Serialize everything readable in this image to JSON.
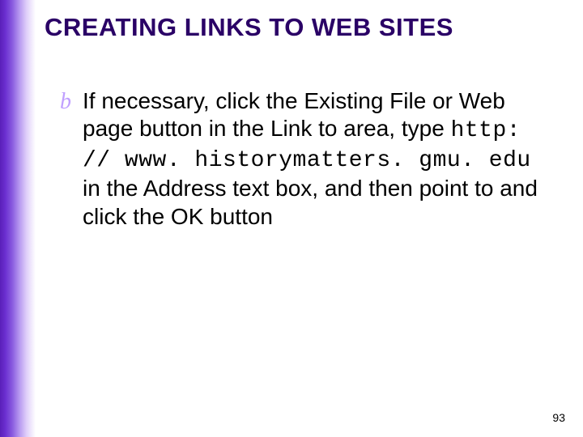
{
  "slide": {
    "title": "CREATING LINKS TO WEB SITES",
    "bullet_glyph": "b",
    "body": {
      "pre": "If necessary, click the Existing File or Web page button in the Link to area, type ",
      "code": "http: // www. historymatters. gmu. edu",
      "post": " in the Address text box, and then point to and click the OK button"
    },
    "page_number": "93"
  }
}
